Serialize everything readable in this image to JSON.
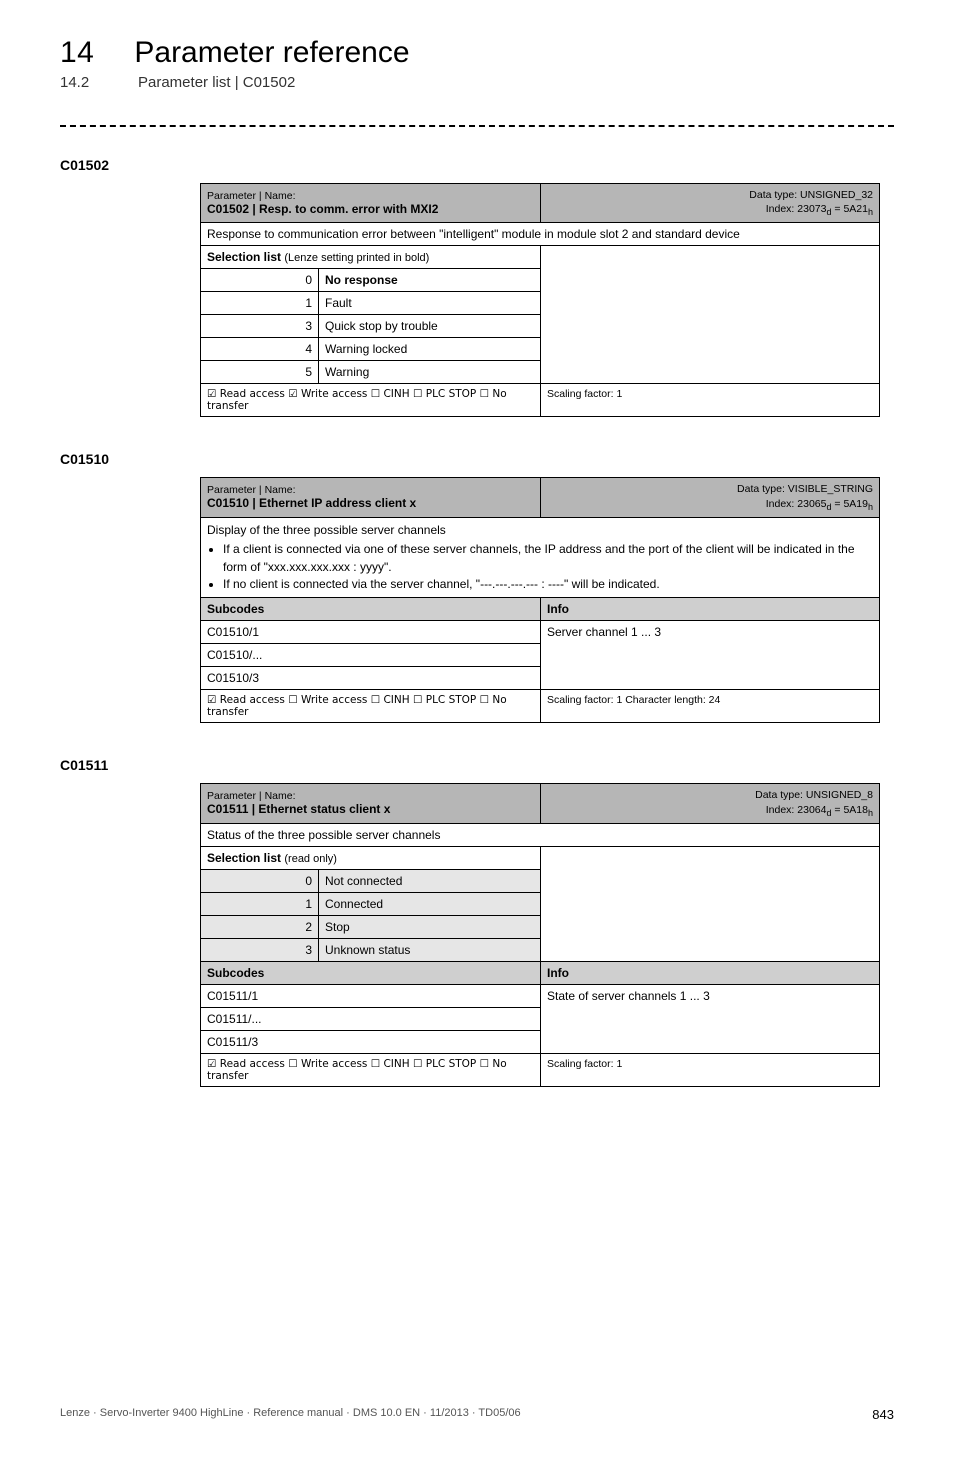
{
  "header": {
    "chapter_number": "14",
    "chapter_title": "Parameter reference",
    "section_number": "14.2",
    "section_title": "Parameter list | C01502"
  },
  "blocks": [
    {
      "id": "C01502",
      "hdr": {
        "param_label": "Parameter | Name:",
        "code_title": "C01502 | Resp. to comm. error with MXI2",
        "type_line": "Data type: UNSIGNED_32",
        "index_line_pre": "Index: 23073",
        "index_line_mid": "d",
        "index_line_mid2": " = 5A21",
        "index_line_suf": "h"
      },
      "description": "Response to communication error between \"intelligent\" module in module slot 2 and standard device",
      "selection_label": "Selection list",
      "selection_paren": "(Lenze setting printed in bold)",
      "selection": [
        {
          "n": "0",
          "v": "No response",
          "bold": true
        },
        {
          "n": "1",
          "v": "Fault"
        },
        {
          "n": "3",
          "v": "Quick stop by trouble"
        },
        {
          "n": "4",
          "v": "Warning locked"
        },
        {
          "n": "5",
          "v": "Warning"
        }
      ],
      "access_left": "☑ Read access   ☑ Write access   ☐ CINH   ☐ PLC STOP   ☐ No transfer",
      "access_right": "Scaling factor: 1"
    },
    {
      "id": "C01510",
      "hdr": {
        "param_label": "Parameter | Name:",
        "code_title": "C01510 | Ethernet IP address client x",
        "type_line": "Data type: VISIBLE_STRING",
        "index_line_pre": "Index: 23065",
        "index_line_mid": "d",
        "index_line_mid2": " = 5A19",
        "index_line_suf": "h"
      },
      "description_lead": "Display of the three possible server channels",
      "bullets": [
        "If a client is connected via one of these server channels, the IP address and the port of the client will be indicated in the form of \"xxx.xxx.xxx.xxx : yyyy\".",
        "If no client is connected via the server channel, \"---.---.---.--- : ----\" will be indicated."
      ],
      "subcodes_label": "Subcodes",
      "info_label": "Info",
      "subcodes": [
        "C01510/1",
        "C01510/...",
        "C01510/3"
      ],
      "info_value": "Server channel 1 ... 3",
      "access_left": "☑ Read access   ☐ Write access   ☐ CINH   ☐ PLC STOP   ☐ No transfer",
      "access_right": "Scaling factor: 1     Character length: 24"
    },
    {
      "id": "C01511",
      "hdr": {
        "param_label": "Parameter | Name:",
        "code_title": "C01511 | Ethernet status client x",
        "type_line": "Data type: UNSIGNED_8",
        "index_line_pre": "Index: 23064",
        "index_line_mid": "d",
        "index_line_mid2": " = 5A18",
        "index_line_suf": "h"
      },
      "description": "Status of the three possible server channels",
      "selection_label": "Selection list",
      "selection_paren": "(read only)",
      "selection": [
        {
          "n": "0",
          "v": "Not connected"
        },
        {
          "n": "1",
          "v": "Connected"
        },
        {
          "n": "2",
          "v": "Stop"
        },
        {
          "n": "3",
          "v": "Unknown status"
        }
      ],
      "selection_tint": true,
      "subcodes_label": "Subcodes",
      "info_label": "Info",
      "subcodes": [
        "C01511/1",
        "C01511/...",
        "C01511/3"
      ],
      "info_value": "State of server channels 1 ... 3",
      "access_left": "☑ Read access   ☐ Write access   ☐ CINH   ☐ PLC STOP   ☐ No transfer",
      "access_right": "Scaling factor: 1"
    }
  ],
  "footer": {
    "left": "Lenze · Servo-Inverter 9400 HighLine · Reference manual · DMS 10.0 EN · 11/2013 · TD05/06",
    "right": "843"
  }
}
